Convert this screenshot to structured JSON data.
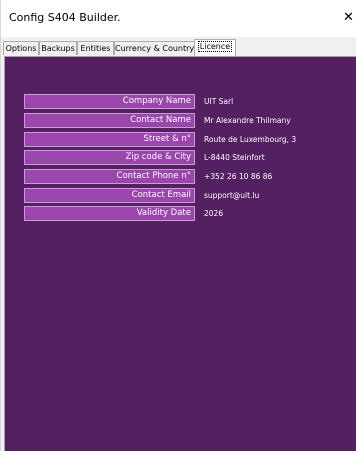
{
  "window": {
    "title": "Config S404 Builder.",
    "close_glyph": "✕"
  },
  "tabs": [
    {
      "label": "Options",
      "active": false
    },
    {
      "label": "Backups",
      "active": false
    },
    {
      "label": "Entities",
      "active": false
    },
    {
      "label": "Currency & Country",
      "active": false
    },
    {
      "label": "Licence",
      "active": true
    }
  ],
  "licence": {
    "fields": [
      {
        "label": "Company Name",
        "value": "UIT Sarl"
      },
      {
        "label": "Contact Name",
        "value": "Mr Alexandre Thilmany"
      },
      {
        "label": "Street & n°",
        "value": "Route de Luxembourg, 3"
      },
      {
        "label": "Zip code & City",
        "value": "L-8440  Steinfort"
      },
      {
        "label": "Contact Phone n°",
        "value": " +352 26 10 86 86"
      },
      {
        "label": "Contact Email",
        "value": "support@uit.lu"
      },
      {
        "label": "Validity Date",
        "value": "2026"
      }
    ]
  },
  "colors": {
    "panel_bg": "#542061",
    "label_bg": "#9a46ad",
    "label_border": "#c99cd6",
    "text": "#ffffff"
  }
}
